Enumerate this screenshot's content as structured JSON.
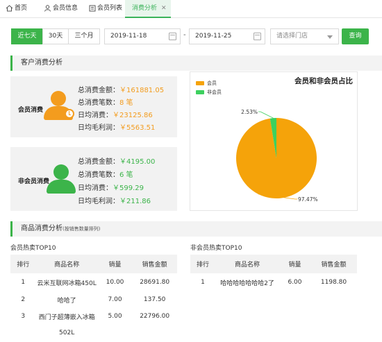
{
  "tabs": [
    {
      "label": "首页",
      "icon": "home-icon"
    },
    {
      "label": "会员信息",
      "icon": "user-icon"
    },
    {
      "label": "会员列表",
      "icon": "list-icon"
    },
    {
      "label": "消费分析",
      "icon": null,
      "close": "✕"
    }
  ],
  "filter": {
    "ranges": [
      "近七天",
      "30天",
      "三个月"
    ],
    "active_range": "近七天",
    "start_date": "2019-11-18",
    "end_date": "2019-11-25",
    "separator": "-",
    "store_placeholder": "请选择门店",
    "query_label": "查询"
  },
  "section1": {
    "title": "客户消费分析"
  },
  "member_card": {
    "title": "会员消费",
    "rows": [
      {
        "label": "总消费金额：",
        "value": "￥161881.05"
      },
      {
        "label": "总消费笔数：",
        "value": "8 笔"
      },
      {
        "label": "日均消费：",
        "value": "￥23125.86"
      },
      {
        "label": "日均毛利润：",
        "value": "￥5563.51"
      }
    ]
  },
  "nonmember_card": {
    "title": "非会员消费",
    "rows": [
      {
        "label": "总消费金额：",
        "value": "￥4195.00"
      },
      {
        "label": "总消费笔数：",
        "value": "6 笔"
      },
      {
        "label": "日均消费：",
        "value": "￥599.29"
      },
      {
        "label": "日均毛利润：",
        "value": "￥211.86"
      }
    ]
  },
  "chart_data": {
    "type": "pie",
    "title": "会员和非会员占比",
    "slices": [
      {
        "name": "会员",
        "value": 97.47,
        "label": "97.47%",
        "color": "#f5a30a"
      },
      {
        "name": "非会员",
        "value": 2.53,
        "label": "2.53%",
        "color": "#3dd05e"
      }
    ]
  },
  "section2": {
    "title": "商品消费分析",
    "subtitle": "(按销售数量排列)"
  },
  "member_top": {
    "title": "会员热卖TOP10",
    "headers": [
      "排行",
      "商品名称",
      "销量",
      "销售金额"
    ],
    "rows": [
      [
        "1",
        "云米互联网冰箱450L",
        "10.00",
        "28691.80"
      ],
      [
        "2",
        "哈哈了",
        "7.00",
        "137.50"
      ],
      [
        "3",
        "西门子超薄嵌入冰箱",
        "5.00",
        "22796.00"
      ]
    ],
    "row3_wrap": "502L"
  },
  "nonmember_top": {
    "title": "非会员热卖TOP10",
    "headers": [
      "排行",
      "商品名称",
      "销量",
      "销售金额"
    ],
    "rows": [
      [
        "1",
        "哈哈哈哈哈哈哈2了",
        "6.00",
        "1198.80"
      ]
    ]
  },
  "colors": {
    "accent": "#3cb44a",
    "member": "#f39c1e",
    "nonmember": "#3cb44a"
  }
}
